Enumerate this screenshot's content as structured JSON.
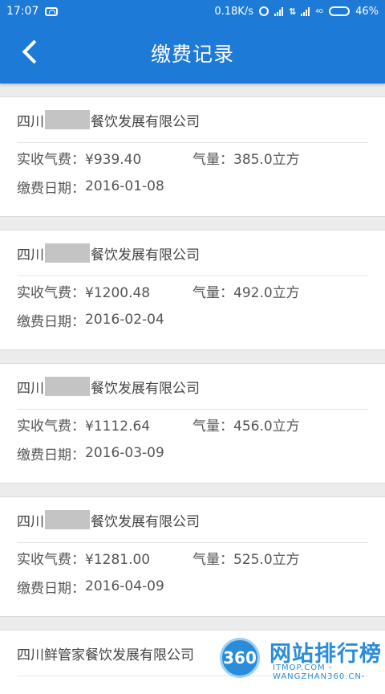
{
  "status_bar": {
    "time": "17:07",
    "net_speed": "0.18K/s",
    "data_label": "4G",
    "battery": "46%"
  },
  "header": {
    "title": "缴费记录"
  },
  "labels": {
    "amount": "实收气费：",
    "volume": "气量：",
    "date": "缴费日期："
  },
  "records": [
    {
      "company_prefix": "四川",
      "company_suffix": "餐饮发展有限公司",
      "amount": "¥939.40",
      "volume": "385.0立方",
      "date": "2016-01-08"
    },
    {
      "company_prefix": "四川",
      "company_suffix": "餐饮发展有限公司",
      "amount": "¥1200.48",
      "volume": "492.0立方",
      "date": "2016-02-04"
    },
    {
      "company_prefix": "四川",
      "company_suffix": "餐饮发展有限公司",
      "amount": "¥1112.64",
      "volume": "456.0立方",
      "date": "2016-03-09"
    },
    {
      "company_prefix": "四川",
      "company_suffix": "餐饮发展有限公司",
      "amount": "¥1281.00",
      "volume": "525.0立方",
      "date": "2016-04-09"
    },
    {
      "company_full": "四川鲜管家餐饮发展有限公司"
    }
  ],
  "watermark": {
    "logo": "360",
    "title": "网站排行榜",
    "site": "ITMOP.COM",
    "url": "-WANGZHAN360.CN-"
  }
}
